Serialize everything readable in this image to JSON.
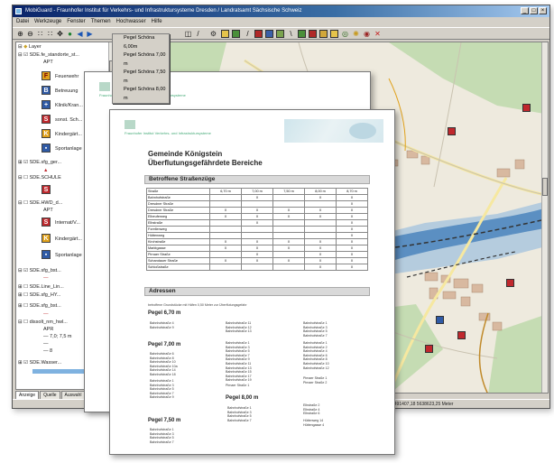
{
  "app": {
    "title": "MobiGuard - Fraunhofer Institut für Verkehrs- und Infrastruktursysteme Dresden / Landratsamt Sächsische Schweiz",
    "menu": [
      "Datei",
      "Werkzeuge",
      "Fenster",
      "Themen",
      "Hochwasser",
      "Hilfe"
    ],
    "dropdown_items": [
      "Pegel Schöna 6,00m",
      "Pegel Schöna 7,00 m",
      "Pegel Schöna 7,50 m",
      "Pegel Schöna 8,00 m"
    ],
    "layers": [
      {
        "label": "Layer"
      },
      {
        "label": "SDE.fe_standorte_st..."
      },
      {
        "label": "APT"
      },
      {
        "label": "Feuerwehr"
      },
      {
        "label": "Betreuung"
      },
      {
        "label": "Klinik/Kran..."
      },
      {
        "label": "sonst. Sch..."
      },
      {
        "label": "Kindergärt..."
      },
      {
        "label": "Sportanlage"
      },
      {
        "label": "SDE.sfg_ger..."
      },
      {
        "label": "SDE.SCHULE"
      },
      {
        "label": "SDE.HWD_d..."
      },
      {
        "label": "APT"
      },
      {
        "label": "Internat/V..."
      },
      {
        "label": "Kindergärt..."
      },
      {
        "label": "Sportanlage"
      },
      {
        "label": "SDE.sfg_bst..."
      },
      {
        "label": "SDE.Line_Lin..."
      },
      {
        "label": "SDE.sfg_HY..."
      },
      {
        "label": "SDE.sfg_bst..."
      },
      {
        "label": "dissolt_nm_hwl..."
      },
      {
        "label": "APR"
      },
      {
        "label": "7,0; 7,5 m"
      },
      {
        "label": "8"
      },
      {
        "label": "SDE.Wasser..."
      }
    ],
    "tabs": [
      "Anzeige",
      "Quelle",
      "Auswahl"
    ],
    "status_text": "4491407,18  5638623,25 Meter",
    "colors": {
      "titlebar": "#0a246a",
      "window": "#d4d0c8",
      "river": "#5b8fc2",
      "forest": "#b7d3a4"
    }
  },
  "back_page": {
    "logo": "Fraunhofer Institut Verkehrs- und Infrastruktursysteme"
  },
  "front_page": {
    "logo": "Fraunhofer Institut Verkehrs- und Infrastruktursysteme",
    "title_line1": "Gemeinde Königstein",
    "title_line2": "Überflutungsgefährdete Bereiche",
    "section1": "Betroffene Straßenzüge",
    "table_headers": [
      "Straße",
      "6,70 m",
      "7,00 m",
      "7,50 m",
      "8,00 m",
      "8,70 m"
    ],
    "table_rows": [
      {
        "street": "Bahnhofstraße",
        "marks": [
          "",
          "X",
          "",
          "X",
          "X"
        ]
      },
      {
        "street": "Dresdner Straße",
        "marks": [
          "",
          "",
          "",
          "",
          "X"
        ]
      },
      {
        "street": "Dresdner Straße",
        "marks": [
          "X",
          "X",
          "X",
          "X",
          "X"
        ]
      },
      {
        "street": "Elbeuferweg",
        "marks": [
          "X",
          "X",
          "X",
          "X",
          "X"
        ]
      },
      {
        "street": "Elbstraße",
        "marks": [
          "",
          "X",
          "",
          "",
          "X"
        ]
      },
      {
        "street": "Forellenweg",
        "marks": [
          "",
          "",
          "",
          "",
          "X"
        ]
      },
      {
        "street": "Hüttenweg",
        "marks": [
          "",
          "",
          "",
          "",
          "X"
        ]
      },
      {
        "street": "Kirchstraße",
        "marks": [
          "X",
          "X",
          "X",
          "X",
          "X"
        ]
      },
      {
        "street": "Marktgasse",
        "marks": [
          "X",
          "X",
          "X",
          "X",
          "X"
        ]
      },
      {
        "street": "Pirnaer Straße",
        "marks": [
          "",
          "X",
          "",
          "X",
          "X"
        ]
      },
      {
        "street": "Schandauer Straße",
        "marks": [
          "X",
          "X",
          "X",
          "X",
          "X"
        ]
      },
      {
        "street": "Schloßstraße",
        "marks": [
          "",
          "",
          "",
          "X",
          "X"
        ]
      }
    ],
    "section2": "Adressen",
    "addr_note": "betroffene Grundstücke mit Häfen 0,50 Meter zur Überflutungsgefahr",
    "levels": [
      "Pegel 6,70 m",
      "Pegel 7,00 m",
      "Pegel 8,00 m",
      "Pegel 7,50 m"
    ],
    "addr_block_a": [
      "Bahnhofstraße 4",
      "Bahnhofstraße 9"
    ],
    "addr_block_b": [
      "Bahnhofstraße 11",
      "Bahnhofstraße 12",
      "Bahnhofstraße 13"
    ],
    "addr_block_c": [
      "Bahnhofstraße 1",
      "Bahnhofstraße 3",
      "Bahnhofstraße 5",
      "Bahnhofstraße 7"
    ],
    "addr_block_d": [
      "Bahnhofstraße 6",
      "Bahnhofstraße 8",
      "Bahnhofstraße 10",
      "Bahnhofstraße 10a",
      "Bahnhofstraße 14",
      "Bahnhofstraße 18"
    ],
    "addr_block_e": [
      "Bahnhofstraße 1",
      "Bahnhofstraße 3",
      "Bahnhofstraße 5",
      "Bahnhofstraße 7",
      "Bahnhofstraße 9",
      "Bahnhofstraße 11",
      "Bahnhofstraße 13",
      "Bahnhofstraße 15",
      "Bahnhofstraße 17",
      "Bahnhofstraße 19"
    ],
    "addr_block_f": [
      "Bahnhofstraße 1",
      "Bahnhofstraße 2",
      "Bahnhofstraße 4",
      "Bahnhofstraße 6",
      "Bahnhofstraße 8",
      "Bahnhofstraße 10",
      "Bahnhofstraße 12"
    ],
    "addr_block_g": [
      "Pirnaer Straße 1"
    ],
    "addr_block_h": [
      "Bahnhofstraße 1",
      "Bahnhofstraße 3",
      "Bahnhofstraße 5",
      "Bahnhofstraße 7",
      "Bahnhofstraße 9"
    ],
    "addr_block_i": [
      "Bahnhofstraße 1",
      "Bahnhofstraße 3",
      "Bahnhofstraße 5",
      "Bahnhofstraße 7"
    ],
    "addr_block_j": [
      "Elbstraße 2",
      "Elbstraße 4",
      "Elbstraße 6"
    ],
    "addr_block_k": [
      "Hüttenweg 14",
      "Hüttengasse 4"
    ],
    "addr_block_l": [
      "Pirnaer Straße 1",
      "Pirnaer Straße 2"
    ]
  }
}
